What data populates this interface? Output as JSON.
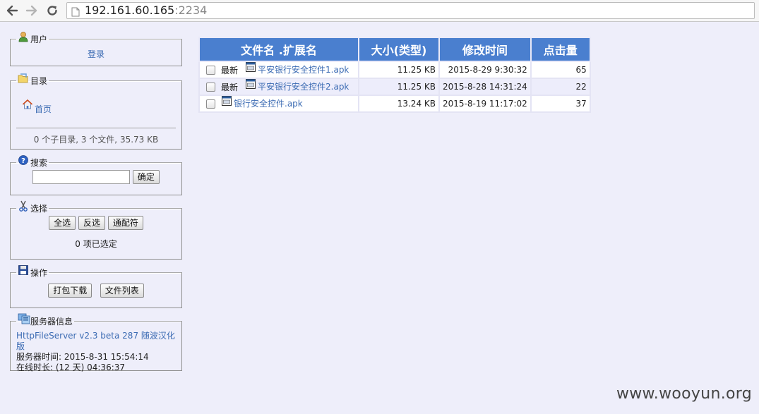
{
  "browser": {
    "url_host": "192.161.60.165",
    "url_port": ":2234"
  },
  "user_panel": {
    "title": "用户",
    "login_link": "登录"
  },
  "dir_panel": {
    "title": "目录",
    "home_link": "首页",
    "summary": "0 个子目录, 3 个文件, 35.73 KB"
  },
  "search_panel": {
    "title": "搜索",
    "input_value": "",
    "submit_label": "确定"
  },
  "select_panel": {
    "title": "选择",
    "select_all": "全选",
    "invert": "反选",
    "wildcard": "通配符",
    "status": "0 项已选定"
  },
  "ops_panel": {
    "title": "操作",
    "pack_download": "打包下载",
    "file_list": "文件列表"
  },
  "server_panel": {
    "title": "服务器信息",
    "version_link": "HttpFileServer v2.3 beta 287 随波汉化版",
    "server_time": "服务器时间: 2015-8-31 15:54:14",
    "uptime": "在线时长: (12 天) 04:36:37"
  },
  "table": {
    "headers": [
      "文件名 .扩展名",
      "大小(类型)",
      "修改时间",
      "点击量"
    ],
    "rows": [
      {
        "tag": "最新",
        "name": "平安银行安全控件1.apk",
        "size": "11.25 KB",
        "modified": "2015-8-29 9:30:32",
        "hits": "65"
      },
      {
        "tag": "最新",
        "name": "平安银行安全控件2.apk",
        "size": "11.25 KB",
        "modified": "2015-8-28 14:31:24",
        "hits": "22"
      },
      {
        "tag": "",
        "name": "银行安全控件.apk",
        "size": "13.24 KB",
        "modified": "2015-8-19 11:17:02",
        "hits": "37"
      }
    ]
  },
  "watermark": "www.wooyun.org",
  "icons": {
    "back": "arrow-left-icon",
    "forward": "arrow-right-icon",
    "reload": "reload-icon",
    "page": "page-icon",
    "user": "user-icon",
    "folder": "folder-icon",
    "home": "home-icon",
    "search": "help-search-icon",
    "select": "scissors-icon",
    "ops": "floppy-disk-icon",
    "server": "server-icon",
    "file": "file-apk-icon"
  },
  "colors": {
    "page_bg": "#eeeefa",
    "header_bg": "#4a7fcf",
    "link": "#3b6bb3"
  }
}
